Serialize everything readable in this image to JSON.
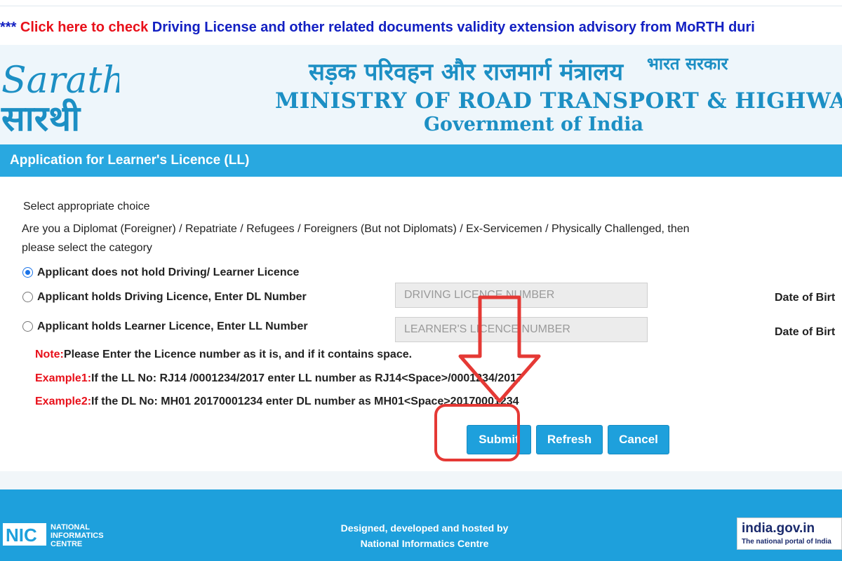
{
  "marquee": {
    "prefix": "*** ",
    "link": "Click here to check",
    "text": " Driving License and other related documents validity extension advisory from MoRTH duri"
  },
  "header": {
    "logo_latin": "Sarathi",
    "logo_hindi": "सारथी",
    "hindi_title": "सड़क परिवहन और राजमार्ग मंत्रालय",
    "hindi_sub": "भारत सरकार",
    "ministry": "MINISTRY OF ROAD TRANSPORT & HIGHWAYS",
    "government": "Government of India"
  },
  "page_title": "Application for Learner's Licence (LL)",
  "form": {
    "select_label": "Select appropriate choice",
    "category_line1": "Are you a Diplomat (Foreigner) / Repatriate / Refugees / Foreigners (But not Diplomats) / Ex-Servicemen / Physically Challenged, then",
    "category_line2": "please select the category",
    "options": [
      {
        "label": "Applicant does not hold Driving/ Learner Licence",
        "checked": true
      },
      {
        "label": "Applicant holds Driving Licence, Enter DL Number",
        "checked": false
      },
      {
        "label": "Applicant holds Learner Licence, Enter LL Number",
        "checked": false
      }
    ],
    "dl_placeholder": "DRIVING LICENCE NUMBER",
    "ll_placeholder": "LEARNER'S LICENCE NUMBER",
    "dob_label_1": "Date of Birt",
    "dob_label_2": "Date of Birt",
    "note_label": "Note:",
    "note_text": "Please Enter the Licence number as it is, and if it contains space.",
    "example1_label": "Example1:",
    "example1_text": "If the LL No: RJ14 /0001234/2017 enter LL number as RJ14<Space>/0001234/2017",
    "example2_label": "Example2:",
    "example2_text": "If the DL No: MH01 20170001234 enter DL number as MH01<Space>20170001234"
  },
  "buttons": {
    "submit": "Submit",
    "refresh": "Refresh",
    "cancel": "Cancel"
  },
  "footer": {
    "nic_line1": "NATIONAL",
    "nic_line2": "INFORMATICS",
    "nic_line3": "CENTRE",
    "credit_line1": "Designed, developed and hosted by",
    "credit_line2": "National Informatics Centre",
    "india_gov": "india.gov.in",
    "india_gov_sub": "The national portal of India"
  },
  "colors": {
    "accent": "#29a8e0",
    "button": "#1ea0dc",
    "header_bg": "#eef6fb",
    "link_red": "#e8101a",
    "link_blue": "#1320c2",
    "annotation": "#e53935"
  }
}
